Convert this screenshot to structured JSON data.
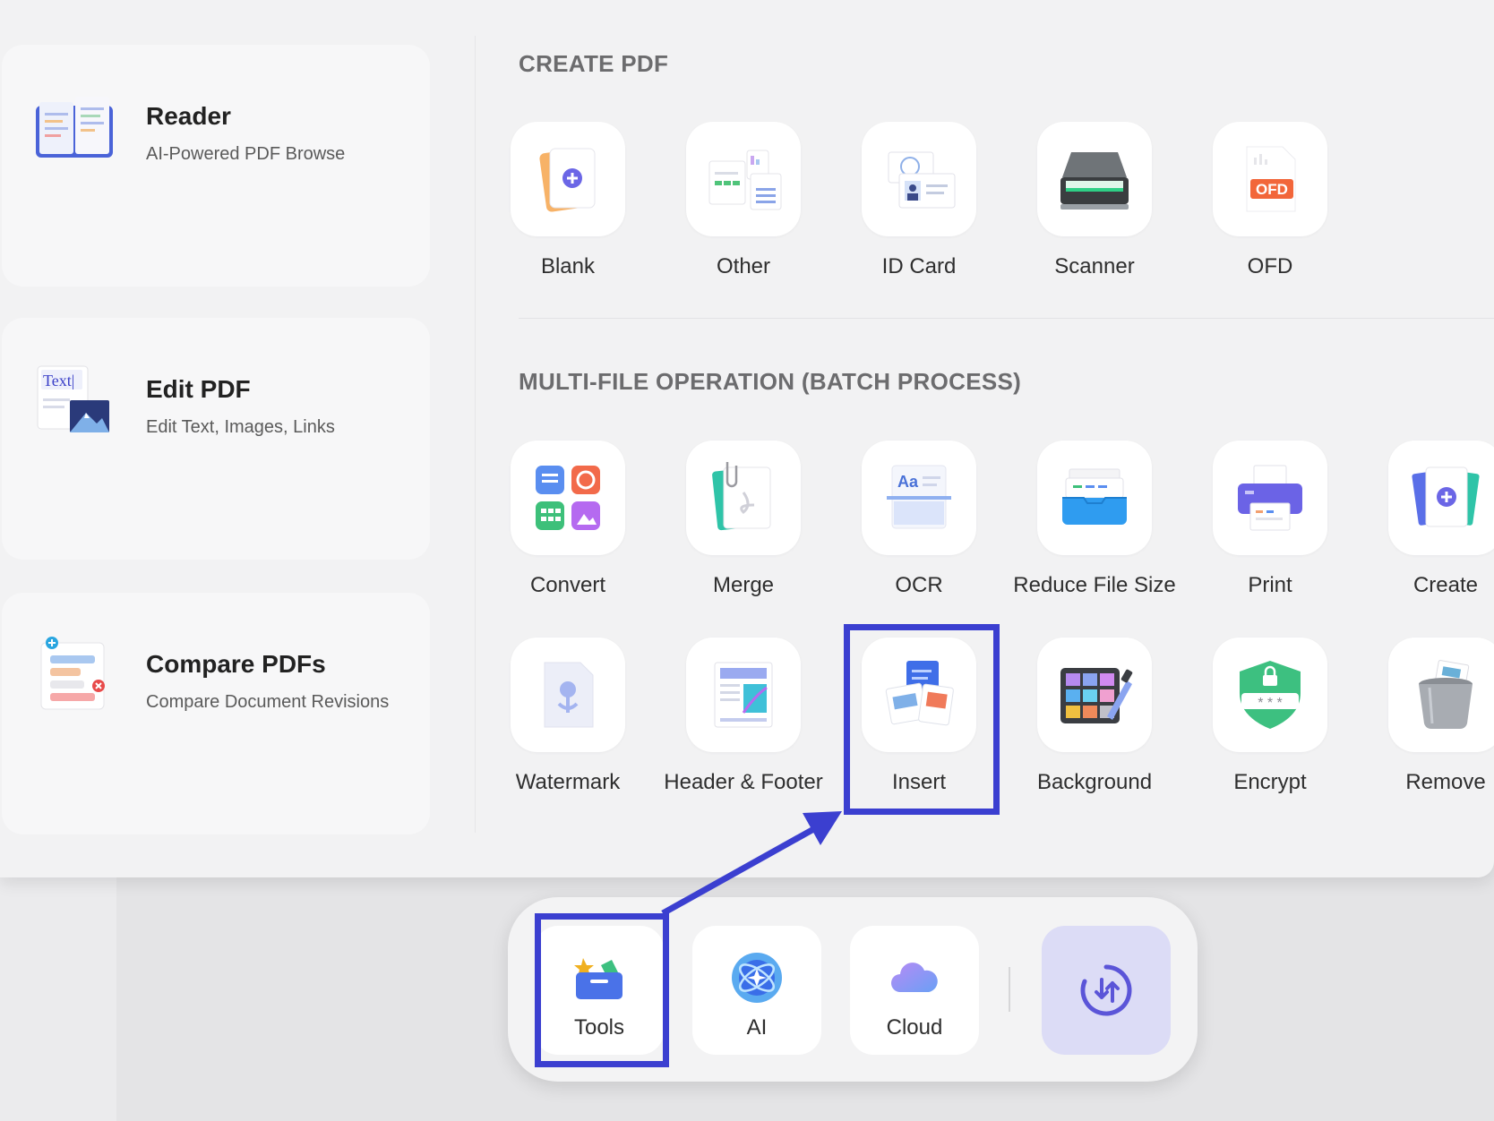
{
  "left_cards": [
    {
      "title": "Reader",
      "subtitle": "AI-Powered PDF Browse"
    },
    {
      "title": "Edit PDF",
      "subtitle": "Edit Text, Images, Links"
    },
    {
      "title": "Compare PDFs",
      "subtitle": "Compare Document Revisions"
    }
  ],
  "edit_icon_text": "Text|",
  "create_pdf": {
    "title": "CREATE PDF",
    "items": [
      "Blank",
      "Other",
      "ID Card",
      "Scanner",
      "OFD"
    ]
  },
  "ofd_badge": "OFD",
  "multi_file": {
    "title": "MULTI-FILE OPERATION (BATCH PROCESS)",
    "row1": [
      "Convert",
      "Merge",
      "OCR",
      "Reduce File Size",
      "Print",
      "Create"
    ],
    "row2": [
      "Watermark",
      "Header & Footer",
      "Insert",
      "Background",
      "Encrypt",
      "Remove"
    ]
  },
  "ocr_icon_text": "Aa",
  "dock": {
    "items": [
      "Tools",
      "AI",
      "Cloud"
    ]
  },
  "colors": {
    "highlight": "#3b3fd0",
    "panel_bg": "#f2f2f3",
    "tile_bg": "#ffffff",
    "section_title": "#6c6c6e"
  }
}
